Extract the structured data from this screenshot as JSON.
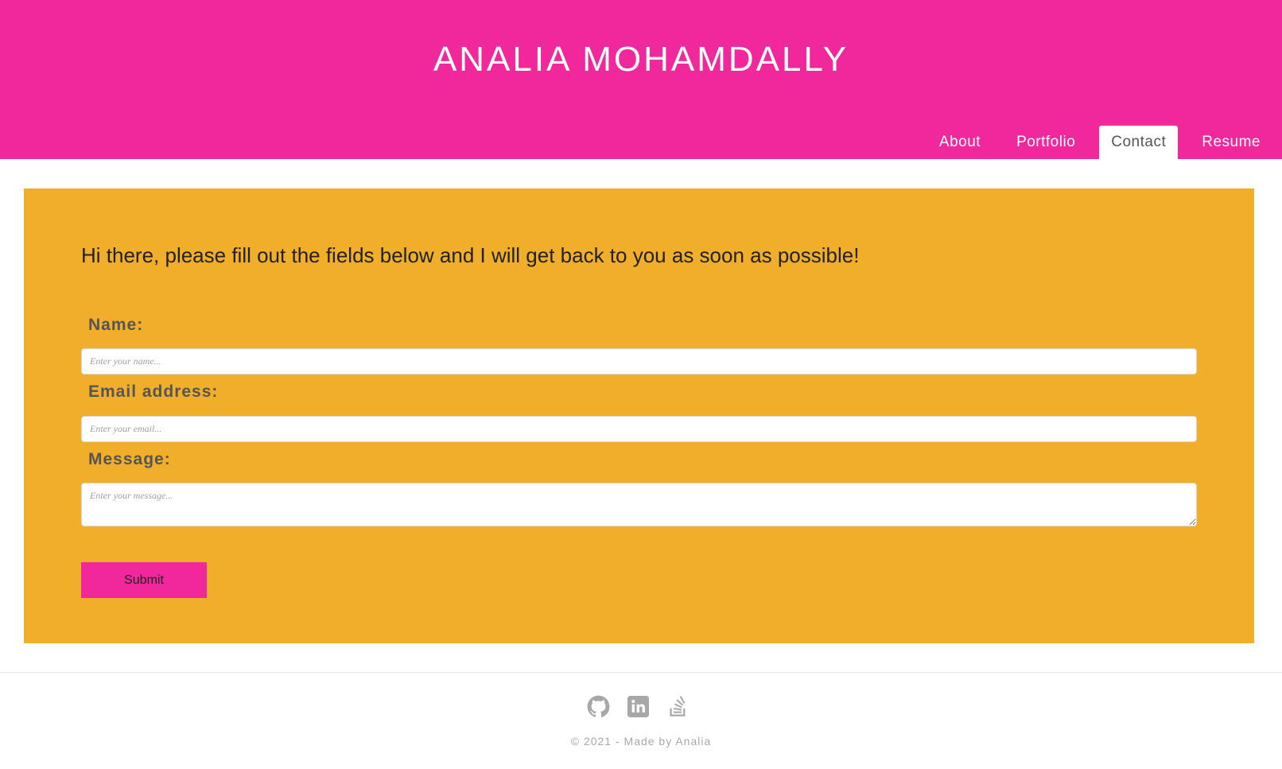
{
  "header": {
    "title": "ANALIA MOHAMDALLY",
    "nav": [
      {
        "label": "About"
      },
      {
        "label": "Portfolio"
      },
      {
        "label": "Contact"
      },
      {
        "label": "Resume"
      }
    ],
    "active_nav": "Contact",
    "background_color": "#f0289b"
  },
  "contact": {
    "intro": "Hi there, please fill out the fields below and I will get back to you as soon as possible!",
    "background_color": "#f0ae2a",
    "fields": {
      "name": {
        "label": "Name:",
        "placeholder": "Enter your name..."
      },
      "email": {
        "label": "Email address:",
        "placeholder": "Enter your email..."
      },
      "message": {
        "label": "Message:",
        "placeholder": "Enter your message..."
      }
    },
    "submit_label": "Submit"
  },
  "footer": {
    "social_icons": [
      "github-icon",
      "linkedin-icon",
      "stackoverflow-icon"
    ],
    "copyright": "© 2021 - Made by Analia"
  }
}
